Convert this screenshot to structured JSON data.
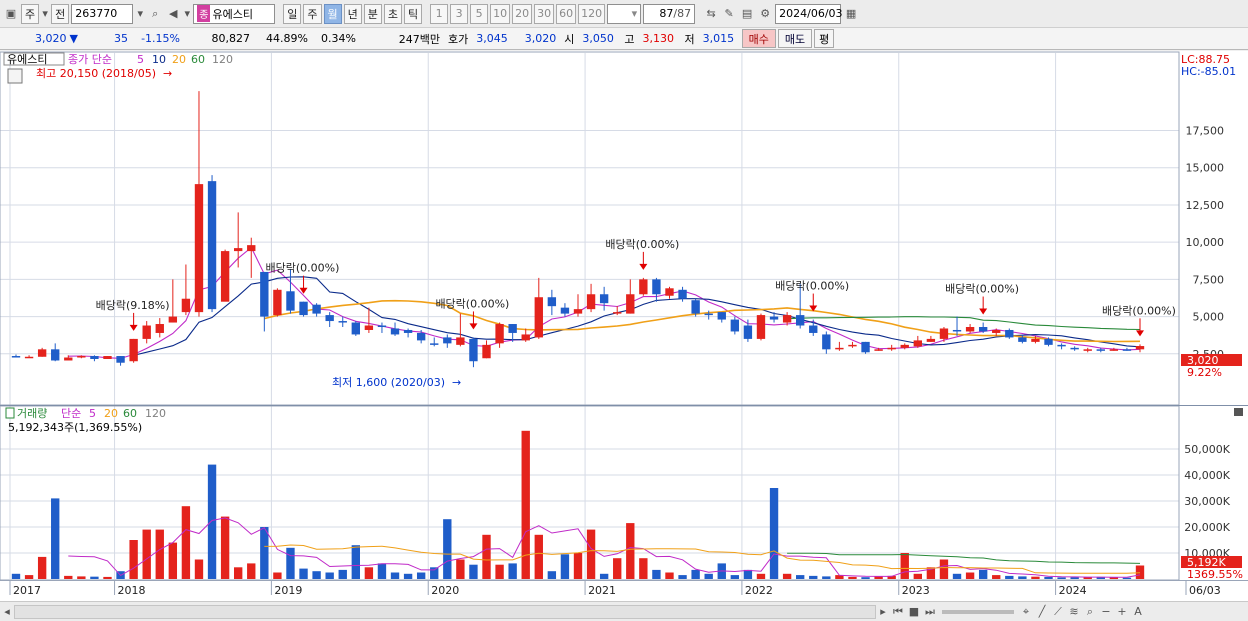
{
  "toolbar": {
    "main_btn": "주",
    "prev_btn": "전",
    "code": "263770",
    "stock_badge": "종",
    "stock_name": "유에스티",
    "periods": [
      "일",
      "주",
      "월",
      "년",
      "분",
      "초",
      "틱"
    ],
    "active_period": "월",
    "intervals": [
      "1",
      "3",
      "5",
      "10",
      "20",
      "30",
      "60",
      "120"
    ],
    "count_value": "87",
    "count_total": "/87",
    "date": "2024/06/03"
  },
  "quote": {
    "price": "3,020",
    "arrow": "▼",
    "change": "35",
    "change_pct": "-1.15%",
    "volume": "80,827",
    "rate1": "44.89%",
    "rate2": "0.34%",
    "amount": "247백만",
    "ask_label": "호가",
    "ask1": "3,045",
    "ask2": "3,020",
    "open_label": "시",
    "open": "3,050",
    "high_label": "고",
    "high": "3,130",
    "low_label": "저",
    "low": "3,015",
    "buy_label": "매수",
    "sell_label": "매도",
    "eval_label": "평"
  },
  "colors": {
    "up": "#e4231c",
    "down": "#1f5dc9",
    "ma5": "#c02ac8",
    "ma10": "#0a2a8a",
    "ma20": "#f0a018",
    "ma60": "#2a8a3a",
    "ma120": "#808080",
    "grid": "#d6dbe6"
  },
  "price_panel": {
    "name": "유에스티",
    "legend_label": "종가 단순",
    "ma_periods": [
      "5",
      "10",
      "20",
      "60",
      "120"
    ],
    "lc": "LC:88.75",
    "hc": "HC:-85.01",
    "high_note": "최고 20,150 (2018/05)",
    "low_note": "최저 1,600 (2020/03)",
    "last_price": "3,020",
    "last_pct": "9.22%",
    "dividend_labels": [
      "배당락(9.18%)",
      "배당락(0.00%)",
      "배당락(0.00%)",
      "배당락(0.00%)",
      "배당락(0.00%)",
      "배당락(0.00%)",
      "배당락(0.00%)"
    ]
  },
  "volume_panel": {
    "title": "거래량",
    "legend_label": "단순",
    "ma_periods": [
      "5",
      "20",
      "60",
      "120"
    ],
    "summary": "5,192,343주(1,369.55%)",
    "last_vol": "5,192K",
    "last_pct": "1369.55%"
  },
  "chart_data": {
    "type": "candlestick",
    "price_axis": {
      "ticks": [
        2500,
        5000,
        7500,
        10000,
        12500,
        15000,
        17500
      ],
      "tick_labels": [
        "2,500",
        "5,000",
        "7,500",
        "10,000",
        "12,500",
        "15,000",
        "17,500"
      ],
      "ylim": [
        0,
        21500
      ]
    },
    "volume_axis": {
      "ticks": [
        10000,
        20000,
        30000,
        40000,
        50000
      ],
      "tick_labels": [
        "10,000K",
        "20,000K",
        "30,000K",
        "40,000K",
        "50,000K"
      ],
      "ylim": [
        0,
        60000
      ]
    },
    "x_labels": [
      "2017",
      "2018",
      "2019",
      "2020",
      "2021",
      "2022",
      "2023",
      "2024",
      "06/03"
    ],
    "x_label_index": [
      0,
      8,
      20,
      32,
      44,
      56,
      68,
      80,
      86
    ],
    "candles": [
      [
        2350,
        2300,
        2450,
        2250
      ],
      [
        2300,
        2300,
        2400,
        2250
      ],
      [
        2300,
        2800,
        2900,
        2300
      ],
      [
        2800,
        2050,
        3200,
        2000
      ],
      [
        2050,
        2250,
        2400,
        2050
      ],
      [
        2250,
        2350,
        2400,
        2200
      ],
      [
        2350,
        2150,
        2400,
        2000
      ],
      [
        2150,
        2350,
        2350,
        2150
      ],
      [
        2350,
        1900,
        2350,
        1700
      ],
      [
        2000,
        3500,
        3500,
        1900
      ],
      [
        3500,
        4400,
        4700,
        3200
      ],
      [
        3900,
        4500,
        4900,
        3600
      ],
      [
        4600,
        5000,
        7500,
        4600
      ],
      [
        5300,
        6200,
        8500,
        5100
      ],
      [
        5300,
        13900,
        20150,
        5000
      ],
      [
        14100,
        5500,
        14500,
        5300
      ],
      [
        6000,
        9400,
        9500,
        6200
      ],
      [
        9400,
        9600,
        12000,
        8300
      ],
      [
        9400,
        9800,
        10300,
        7600
      ],
      [
        8000,
        5000,
        8000,
        4000
      ],
      [
        5100,
        6800,
        6900,
        5000
      ],
      [
        6700,
        5400,
        8200,
        5200
      ],
      [
        6000,
        5100,
        6000,
        5000
      ],
      [
        5800,
        5200,
        5900,
        5000
      ],
      [
        5100,
        4700,
        5300,
        4300
      ],
      [
        4700,
        4600,
        5000,
        4300
      ],
      [
        4600,
        3800,
        4700,
        3700
      ],
      [
        4100,
        4400,
        5600,
        3900
      ],
      [
        4400,
        4300,
        4600,
        3900
      ],
      [
        4200,
        3800,
        4600,
        3700
      ],
      [
        4100,
        3900,
        4200,
        3600
      ],
      [
        3900,
        3400,
        4100,
        3200
      ],
      [
        3200,
        3100,
        3600,
        3000
      ],
      [
        3600,
        3200,
        3800,
        2900
      ],
      [
        3100,
        3600,
        5200,
        3000
      ],
      [
        3500,
        2000,
        3600,
        1600
      ],
      [
        2200,
        3100,
        3400,
        2200
      ],
      [
        3200,
        4500,
        4600,
        2900
      ],
      [
        4500,
        3900,
        4500,
        3300
      ],
      [
        3400,
        3800,
        4200,
        3300
      ],
      [
        3600,
        6300,
        7600,
        3500
      ],
      [
        6300,
        5700,
        6800,
        5100
      ],
      [
        5600,
        5200,
        5900,
        5000
      ],
      [
        5200,
        5500,
        6500,
        5000
      ],
      [
        5500,
        6500,
        7200,
        5300
      ],
      [
        6500,
        5900,
        7000,
        5400
      ],
      [
        5200,
        5300,
        5700,
        5100
      ],
      [
        5200,
        6500,
        7500,
        5200
      ],
      [
        6500,
        7500,
        7600,
        6400
      ],
      [
        7500,
        6500,
        7600,
        6000
      ],
      [
        6400,
        6900,
        7000,
        6200
      ],
      [
        6800,
        6200,
        7000,
        6000
      ],
      [
        6100,
        5200,
        6200,
        5000
      ],
      [
        5200,
        5100,
        5400,
        4800
      ],
      [
        5300,
        4800,
        5300,
        4600
      ],
      [
        4800,
        4000,
        5000,
        3800
      ],
      [
        4400,
        3500,
        4800,
        3300
      ],
      [
        3500,
        5100,
        5200,
        3400
      ],
      [
        5000,
        4800,
        5300,
        4600
      ],
      [
        4600,
        5100,
        5300,
        4400
      ],
      [
        5100,
        4400,
        7200,
        4200
      ],
      [
        4400,
        3900,
        4800,
        3700
      ],
      [
        3800,
        2800,
        4000,
        2500
      ],
      [
        2800,
        2900,
        3300,
        2700
      ],
      [
        3000,
        3100,
        3300,
        2900
      ],
      [
        3300,
        2600,
        3300,
        2500
      ],
      [
        2700,
        2800,
        2900,
        2700
      ],
      [
        2800,
        2900,
        3100,
        2700
      ],
      [
        2900,
        3100,
        3200,
        2800
      ],
      [
        3000,
        3400,
        3700,
        2900
      ],
      [
        3300,
        3500,
        3700,
        3300
      ],
      [
        3500,
        4200,
        4300,
        3300
      ],
      [
        4100,
        4000,
        5000,
        3700
      ],
      [
        4000,
        4300,
        4500,
        3900
      ],
      [
        4300,
        4000,
        4600,
        3900
      ],
      [
        3900,
        4100,
        4200,
        3700
      ],
      [
        4100,
        3600,
        4200,
        3500
      ],
      [
        3600,
        3300,
        3800,
        3200
      ],
      [
        3300,
        3500,
        3700,
        3200
      ],
      [
        3500,
        3100,
        3600,
        3000
      ],
      [
        3100,
        3000,
        3200,
        2800
      ],
      [
        2900,
        2800,
        3000,
        2700
      ],
      [
        2800,
        2800,
        2900,
        2600
      ],
      [
        2800,
        2700,
        2900,
        2600
      ],
      [
        2700,
        2800,
        2900,
        2700
      ],
      [
        2800,
        2700,
        2900,
        2700
      ],
      [
        2800,
        3020,
        3130,
        2600
      ]
    ],
    "volumes": [
      2000,
      1500,
      8500,
      31000,
      1200,
      1000,
      900,
      800,
      3000,
      15000,
      19000,
      19000,
      14000,
      28000,
      7500,
      44000,
      24000,
      4500,
      6000,
      20000,
      2500,
      12000,
      4000,
      3000,
      2500,
      3500,
      13000,
      4500,
      6000,
      2500,
      2000,
      2500,
      4500,
      23000,
      7500,
      5500,
      17000,
      5500,
      6000,
      57000,
      17000,
      3000,
      9500,
      10000,
      19000,
      2000,
      8000,
      21500,
      8000,
      3500,
      2500,
      1500,
      3500,
      2000,
      6000,
      1500,
      3500,
      2000,
      35000,
      2000,
      1500,
      1200,
      1000,
      1500,
      800,
      700,
      1000,
      1200,
      10000,
      2000,
      4500,
      7500,
      2000,
      2500,
      3500,
      1500,
      1200,
      1000,
      900,
      800,
      600,
      700,
      700,
      800,
      600,
      500,
      5192
    ],
    "dividend_index": [
      9,
      22,
      35,
      48,
      61,
      74,
      87
    ]
  }
}
